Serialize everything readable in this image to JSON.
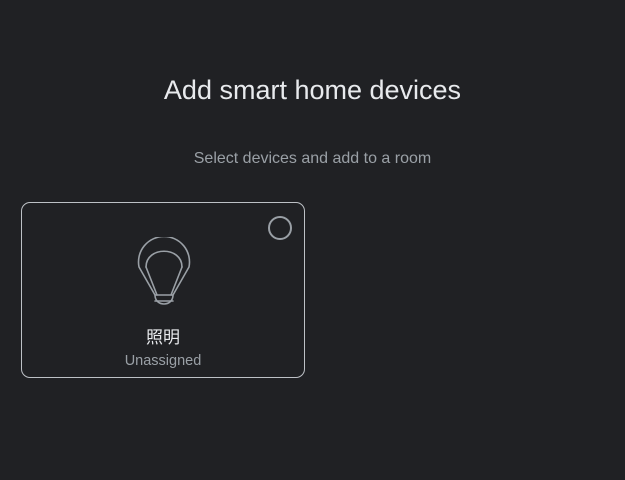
{
  "header": {
    "title": "Add smart home devices",
    "subtitle": "Select devices and add to a room"
  },
  "devices": [
    {
      "name": "照明",
      "room": "Unassigned",
      "icon": "lightbulb-icon",
      "selected": false
    }
  ],
  "colors": {
    "background": "#202124",
    "title_text": "#e8eaed",
    "secondary_text": "#9aa0a6",
    "card_border": "#bdc1c6",
    "icon_stroke": "#9aa0a6"
  }
}
